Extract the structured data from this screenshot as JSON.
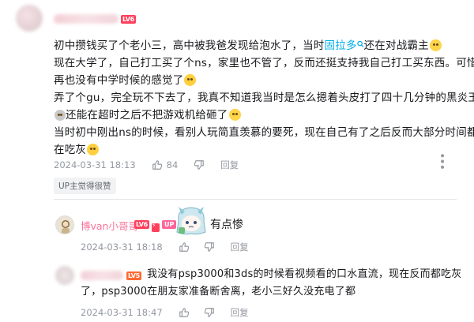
{
  "comment1": {
    "lines": [
      [
        "初中攒钱买了个老小三，高中被我爸发现给泡水了，当时",
        "固拉多",
        "还在对战霸主"
      ],
      [
        "现在大学了，自己打工买了个ns，家里也不管了，反而还挺支持我自己打工买东西。可惜"
      ],
      [
        "再也没有中学时候的感觉了"
      ],
      [
        "弄了个gu，完全玩不下去了，我真不知道我当时是怎么摁着头皮打了四十几分钟的黑炎王"
      ],
      [
        "还能在超时之后不把游戏机给砸了"
      ],
      [
        "当时初中刚出ns的时候，看别人玩简直羡慕的要死，现在自己有了之后反而大部分时间都"
      ],
      [
        "在吃灰"
      ]
    ],
    "level": "LV6",
    "date": "2024-03-31 18:13",
    "likes": "84",
    "reply_label": "回复",
    "up_liked": "UP主觉得很赞"
  },
  "comment2": {
    "username": "博van小哥哥",
    "level": "LV6",
    "up_badge": "UP",
    "text": "有点惨",
    "date": "2024-03-31 18:18",
    "reply_label": "回复"
  },
  "comment3": {
    "level": "LV5",
    "lines": [
      "我没有psp3000和3ds的时候看视频看的口水直流，现在反而都吃灰",
      "了，psp3000在朋友家准备断舍离，老小三好久没充电了都"
    ],
    "date": "2024-03-31 18:47",
    "reply_label": "回复"
  },
  "colors": {
    "accent_link": "#00aeec",
    "pink_name": "#fb7299",
    "meta_grey": "#9499a0",
    "lv6": "#ff3f5c",
    "lv5": "#ff6a33"
  },
  "icons": [
    "like-icon",
    "dislike-icon",
    "more-icon",
    "search-link-icon"
  ]
}
